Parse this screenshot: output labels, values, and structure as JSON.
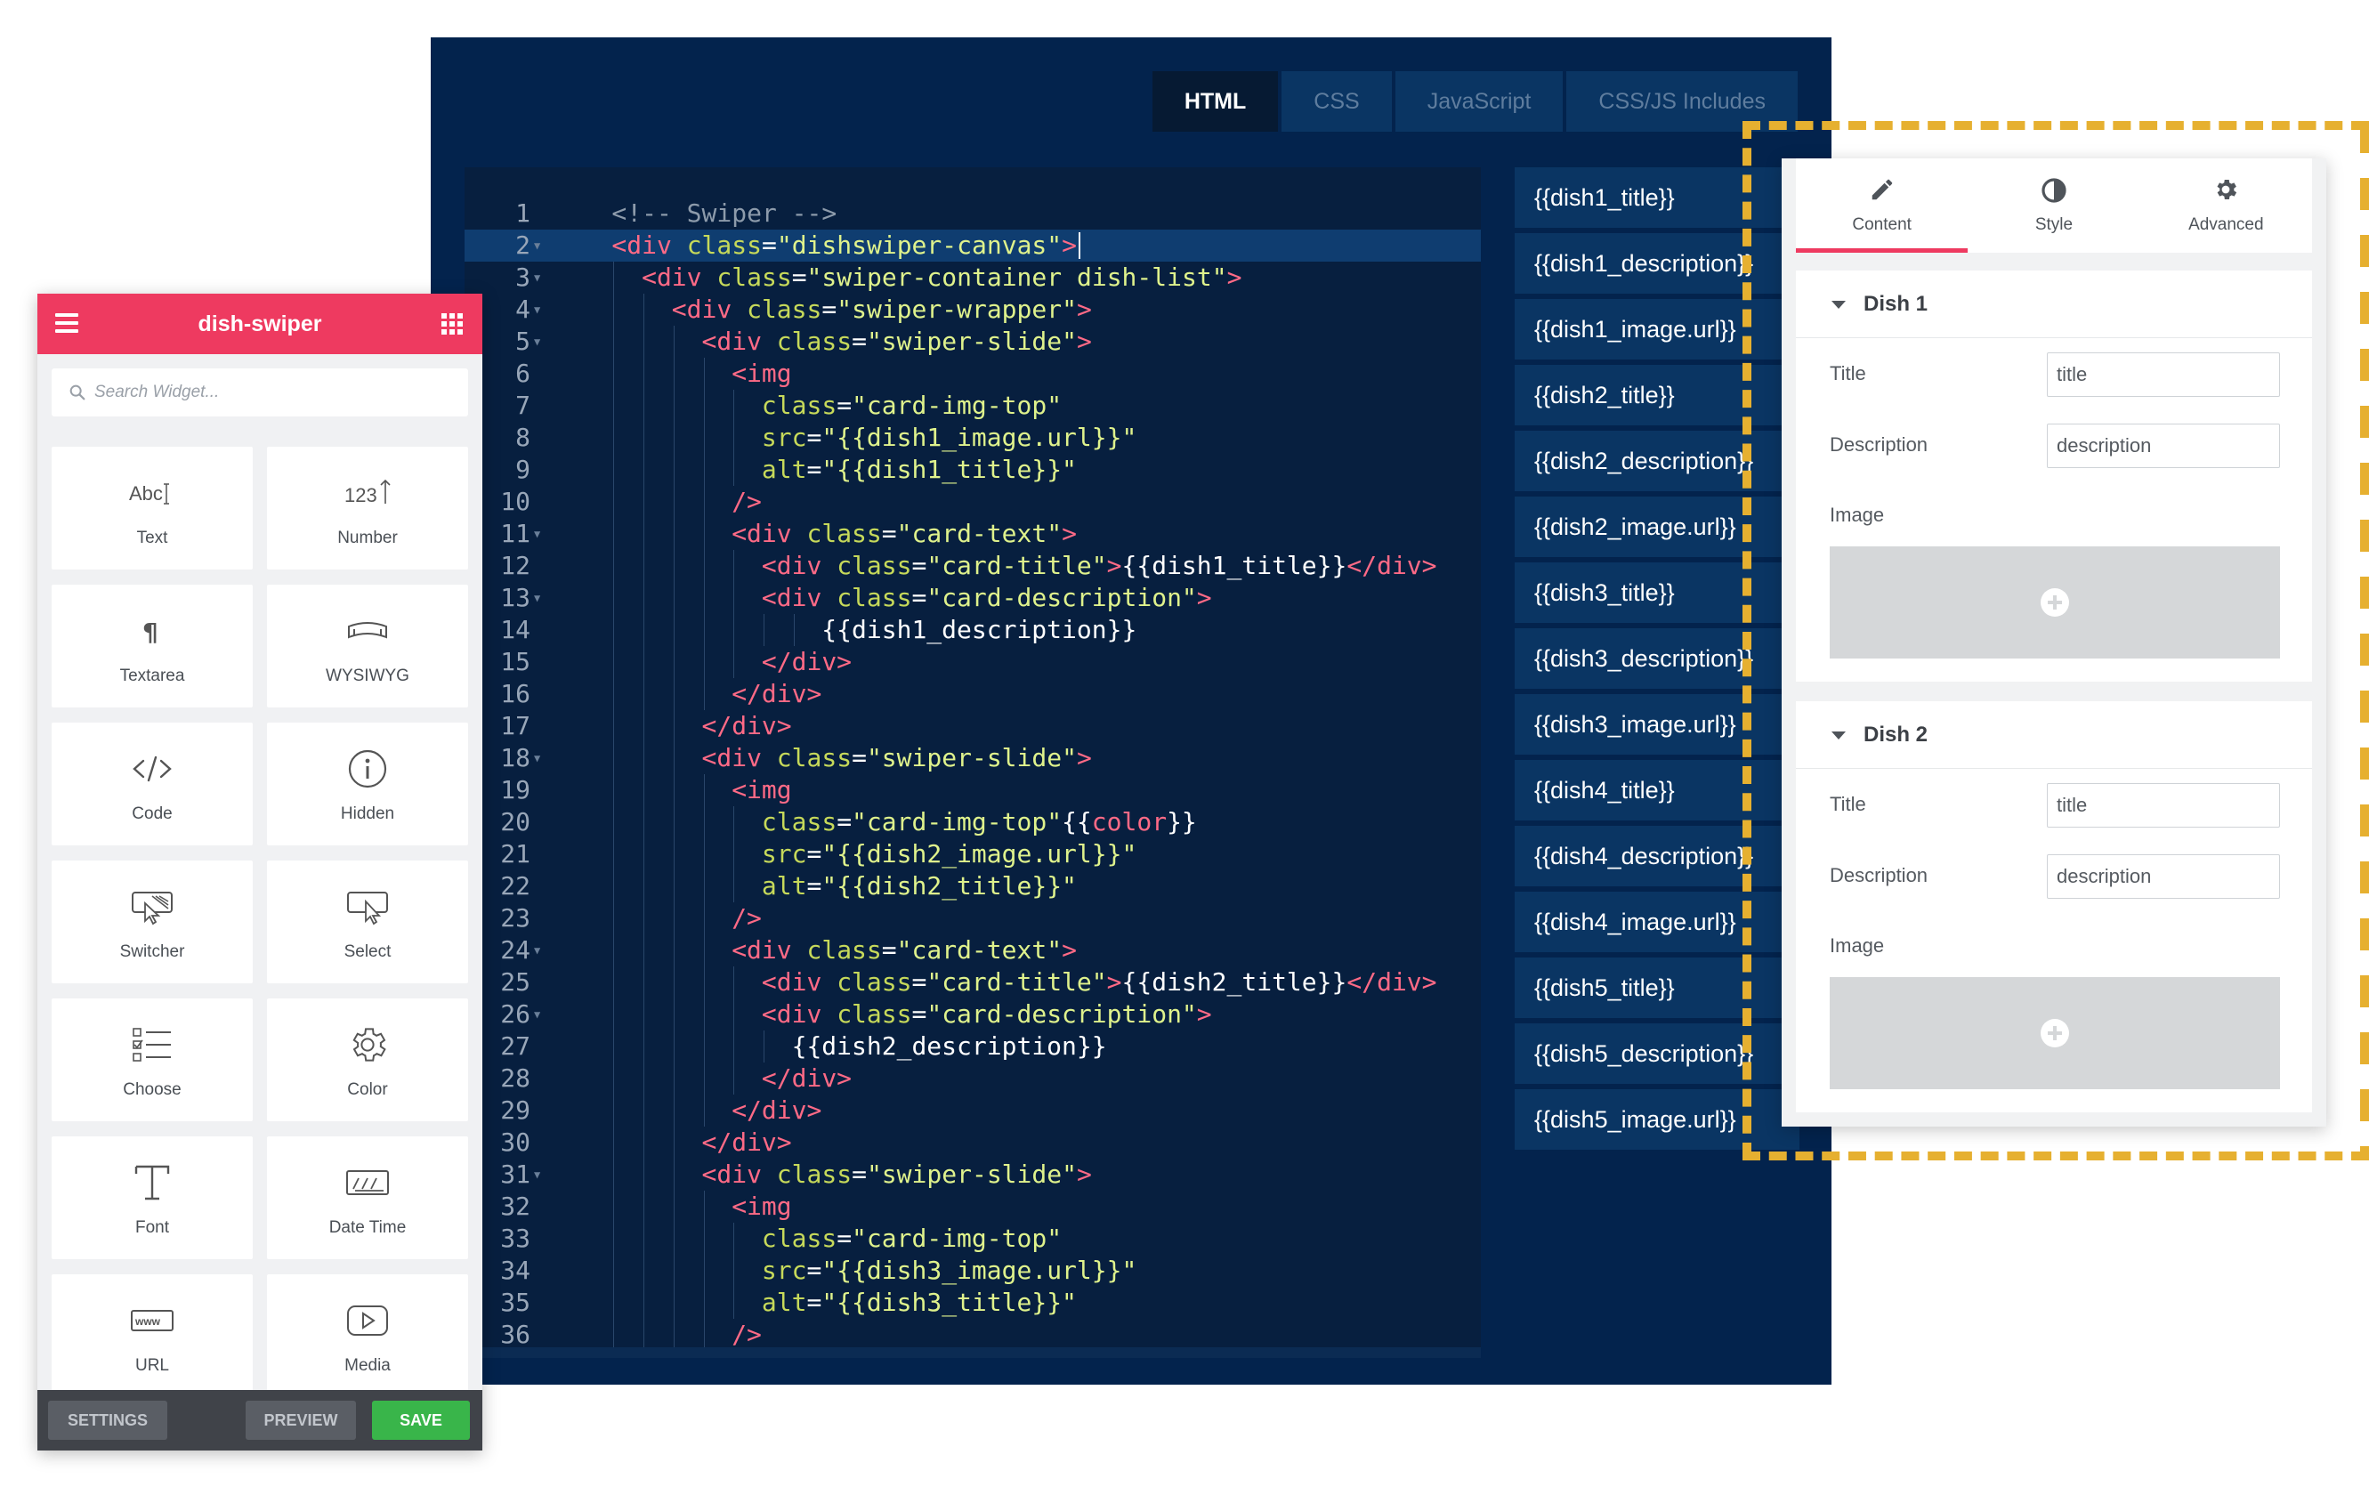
{
  "editor": {
    "tabs": [
      "HTML",
      "CSS",
      "JavaScript",
      "CSS/JS Includes"
    ],
    "active_tab": "HTML",
    "code_lines": [
      {
        "n": "1",
        "indent": 2,
        "parts": [
          [
            "c",
            "<!-- Swiper -->"
          ]
        ]
      },
      {
        "n": "2",
        "indent": 2,
        "fold": true,
        "hl": true,
        "parts": [
          [
            "t",
            "<div "
          ],
          [
            "a",
            "class"
          ],
          [
            "p",
            "="
          ],
          [
            "s",
            "\"dishswiper-canvas\""
          ],
          [
            "t",
            ">"
          ]
        ]
      },
      {
        "n": "3",
        "indent": 3,
        "fold": true,
        "parts": [
          [
            "t",
            "<div "
          ],
          [
            "a",
            "class"
          ],
          [
            "p",
            "="
          ],
          [
            "s",
            "\"swiper-container dish-list\""
          ],
          [
            "t",
            ">"
          ]
        ]
      },
      {
        "n": "4",
        "indent": 4,
        "fold": true,
        "parts": [
          [
            "t",
            "<div "
          ],
          [
            "a",
            "class"
          ],
          [
            "p",
            "="
          ],
          [
            "s",
            "\"swiper-wrapper\""
          ],
          [
            "t",
            ">"
          ]
        ]
      },
      {
        "n": "5",
        "indent": 5,
        "fold": true,
        "parts": [
          [
            "t",
            "<div "
          ],
          [
            "a",
            "class"
          ],
          [
            "p",
            "="
          ],
          [
            "s",
            "\"swiper-slide\""
          ],
          [
            "t",
            ">"
          ]
        ]
      },
      {
        "n": "6",
        "indent": 6,
        "parts": [
          [
            "t",
            "<img"
          ]
        ]
      },
      {
        "n": "7",
        "indent": 7,
        "parts": [
          [
            "a",
            "class"
          ],
          [
            "p",
            "="
          ],
          [
            "s",
            "\"card-img-top\""
          ]
        ]
      },
      {
        "n": "8",
        "indent": 7,
        "parts": [
          [
            "a",
            "src"
          ],
          [
            "p",
            "="
          ],
          [
            "s",
            "\"{{dish1_image.url}}\""
          ]
        ]
      },
      {
        "n": "9",
        "indent": 7,
        "parts": [
          [
            "a",
            "alt"
          ],
          [
            "p",
            "="
          ],
          [
            "s",
            "\"{{dish1_title}}\""
          ]
        ]
      },
      {
        "n": "10",
        "indent": 6,
        "parts": [
          [
            "t",
            "/>"
          ]
        ]
      },
      {
        "n": "11",
        "indent": 6,
        "fold": true,
        "parts": [
          [
            "t",
            "<div "
          ],
          [
            "a",
            "class"
          ],
          [
            "p",
            "="
          ],
          [
            "s",
            "\"card-text\""
          ],
          [
            "t",
            ">"
          ]
        ]
      },
      {
        "n": "12",
        "indent": 7,
        "parts": [
          [
            "t",
            "<div "
          ],
          [
            "a",
            "class"
          ],
          [
            "p",
            "="
          ],
          [
            "s",
            "\"card-title\""
          ],
          [
            "t",
            ">"
          ],
          [
            "x",
            "{{dish1_title}}"
          ],
          [
            "t",
            "</div>"
          ]
        ]
      },
      {
        "n": "13",
        "indent": 7,
        "fold": true,
        "parts": [
          [
            "t",
            "<div "
          ],
          [
            "a",
            "class"
          ],
          [
            "p",
            "="
          ],
          [
            "s",
            "\"card-description\""
          ],
          [
            "t",
            ">"
          ]
        ]
      },
      {
        "n": "14",
        "indent": 9,
        "parts": [
          [
            "x",
            "{{dish1_description}}"
          ]
        ]
      },
      {
        "n": "15",
        "indent": 7,
        "parts": [
          [
            "t",
            "</div>"
          ]
        ]
      },
      {
        "n": "16",
        "indent": 6,
        "parts": [
          [
            "t",
            "</div>"
          ]
        ]
      },
      {
        "n": "17",
        "indent": 5,
        "parts": [
          [
            "t",
            "</div>"
          ]
        ]
      },
      {
        "n": "18",
        "indent": 5,
        "fold": true,
        "parts": [
          [
            "t",
            "<div "
          ],
          [
            "a",
            "class"
          ],
          [
            "p",
            "="
          ],
          [
            "s",
            "\"swiper-slide\""
          ],
          [
            "t",
            ">"
          ]
        ]
      },
      {
        "n": "19",
        "indent": 6,
        "parts": [
          [
            "t",
            "<img"
          ]
        ]
      },
      {
        "n": "20",
        "indent": 7,
        "parts": [
          [
            "a",
            "class"
          ],
          [
            "p",
            "="
          ],
          [
            "s",
            "\"card-img-top\""
          ],
          [
            "x",
            "{{"
          ],
          [
            "t",
            "color"
          ],
          [
            "x",
            "}}"
          ]
        ]
      },
      {
        "n": "21",
        "indent": 7,
        "parts": [
          [
            "a",
            "src"
          ],
          [
            "p",
            "="
          ],
          [
            "s",
            "\"{{dish2_image.url}}\""
          ]
        ]
      },
      {
        "n": "22",
        "indent": 7,
        "parts": [
          [
            "a",
            "alt"
          ],
          [
            "p",
            "="
          ],
          [
            "s",
            "\"{{dish2_title}}\""
          ]
        ]
      },
      {
        "n": "23",
        "indent": 6,
        "parts": [
          [
            "t",
            "/>"
          ]
        ]
      },
      {
        "n": "24",
        "indent": 6,
        "fold": true,
        "parts": [
          [
            "t",
            "<div "
          ],
          [
            "a",
            "class"
          ],
          [
            "p",
            "="
          ],
          [
            "s",
            "\"card-text\""
          ],
          [
            "t",
            ">"
          ]
        ]
      },
      {
        "n": "25",
        "indent": 7,
        "parts": [
          [
            "t",
            "<div "
          ],
          [
            "a",
            "class"
          ],
          [
            "p",
            "="
          ],
          [
            "s",
            "\"card-title\""
          ],
          [
            "t",
            ">"
          ],
          [
            "x",
            "{{dish2_title}}"
          ],
          [
            "t",
            "</div>"
          ]
        ]
      },
      {
        "n": "26",
        "indent": 7,
        "fold": true,
        "parts": [
          [
            "t",
            "<div "
          ],
          [
            "a",
            "class"
          ],
          [
            "p",
            "="
          ],
          [
            "s",
            "\"card-description\""
          ],
          [
            "t",
            ">"
          ]
        ]
      },
      {
        "n": "27",
        "indent": 8,
        "parts": [
          [
            "x",
            "{{dish2_description}}"
          ]
        ]
      },
      {
        "n": "28",
        "indent": 7,
        "parts": [
          [
            "t",
            "</div>"
          ]
        ]
      },
      {
        "n": "29",
        "indent": 6,
        "parts": [
          [
            "t",
            "</div>"
          ]
        ]
      },
      {
        "n": "30",
        "indent": 5,
        "parts": [
          [
            "t",
            "</div>"
          ]
        ]
      },
      {
        "n": "31",
        "indent": 5,
        "fold": true,
        "parts": [
          [
            "t",
            "<div "
          ],
          [
            "a",
            "class"
          ],
          [
            "p",
            "="
          ],
          [
            "s",
            "\"swiper-slide\""
          ],
          [
            "t",
            ">"
          ]
        ]
      },
      {
        "n": "32",
        "indent": 6,
        "parts": [
          [
            "t",
            "<img"
          ]
        ]
      },
      {
        "n": "33",
        "indent": 7,
        "parts": [
          [
            "a",
            "class"
          ],
          [
            "p",
            "="
          ],
          [
            "s",
            "\"card-img-top\""
          ]
        ]
      },
      {
        "n": "34",
        "indent": 7,
        "parts": [
          [
            "a",
            "src"
          ],
          [
            "p",
            "="
          ],
          [
            "s",
            "\"{{dish3_image.url}}\""
          ]
        ]
      },
      {
        "n": "35",
        "indent": 7,
        "parts": [
          [
            "a",
            "alt"
          ],
          [
            "p",
            "="
          ],
          [
            "s",
            "\"{{dish3_title}}\""
          ]
        ]
      },
      {
        "n": "36",
        "indent": 6,
        "parts": [
          [
            "t",
            "/>"
          ]
        ]
      }
    ],
    "tokens": [
      "{{dish1_title}}",
      "{{dish1_description}}",
      "{{dish1_image.url}}",
      "{{dish2_title}}",
      "{{dish2_description}}",
      "{{dish2_image.url}}",
      "{{dish3_title}}",
      "{{dish3_description}}",
      "{{dish3_image.url}}",
      "{{dish4_title}}",
      "{{dish4_description}}",
      "{{dish4_image.url}}",
      "{{dish5_title}}",
      "{{dish5_description}}",
      "{{dish5_image.url}}"
    ]
  },
  "widget_panel": {
    "title": "dish-swiper",
    "search_placeholder": "Search Widget...",
    "widgets": [
      {
        "label": "Text",
        "icon": "text-icon"
      },
      {
        "label": "Number",
        "icon": "number-icon"
      },
      {
        "label": "Textarea",
        "icon": "paragraph-icon"
      },
      {
        "label": "WYSIWYG",
        "icon": "wysiwyg-icon"
      },
      {
        "label": "Code",
        "icon": "code-icon"
      },
      {
        "label": "Hidden",
        "icon": "info-icon"
      },
      {
        "label": "Switcher",
        "icon": "switcher-icon"
      },
      {
        "label": "Select",
        "icon": "select-icon"
      },
      {
        "label": "Choose",
        "icon": "choose-icon"
      },
      {
        "label": "Color",
        "icon": "gear-icon"
      },
      {
        "label": "Font",
        "icon": "font-icon"
      },
      {
        "label": "Date Time",
        "icon": "date-time-icon"
      },
      {
        "label": "URL",
        "icon": "url-icon"
      },
      {
        "label": "Media",
        "icon": "media-icon"
      }
    ],
    "footer": {
      "settings": "SETTINGS",
      "preview": "PREVIEW",
      "save": "SAVE"
    },
    "colors": {
      "header": "#ee3a60",
      "save": "#39b54a"
    }
  },
  "settings_panel": {
    "tabs": [
      {
        "label": "Content",
        "icon": "pencil-icon"
      },
      {
        "label": "Style",
        "icon": "contrast-icon"
      },
      {
        "label": "Advanced",
        "icon": "gear-icon"
      }
    ],
    "active_tab": "Content",
    "sections": [
      {
        "title": "Dish 1",
        "fields": [
          {
            "label": "Title",
            "value": "title"
          },
          {
            "label": "Description",
            "value": "description"
          }
        ],
        "image_label": "Image"
      },
      {
        "title": "Dish 2",
        "fields": [
          {
            "label": "Title",
            "value": "title"
          },
          {
            "label": "Description",
            "value": "description"
          }
        ],
        "image_label": "Image"
      }
    ]
  },
  "accent_colors": {
    "dashed_highlight": "#e6b030",
    "editor_bg": "#03234d"
  }
}
